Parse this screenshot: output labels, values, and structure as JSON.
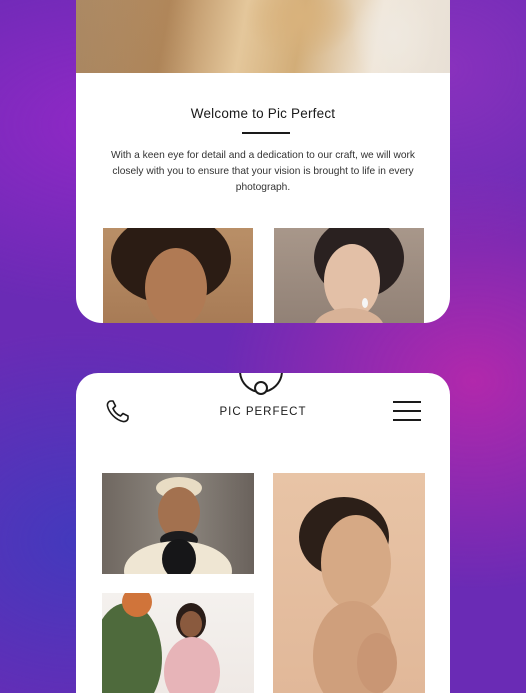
{
  "welcome": {
    "title": "Welcome to Pic Perfect",
    "text": "With a keen eye for detail and a dedication to our craft, we will work closely with you to ensure that your vision is brought to life in every photograph."
  },
  "header": {
    "brand": "PIC PERFECT",
    "phone_icon": "phone-icon",
    "menu_icon": "hamburger-menu-icon"
  }
}
